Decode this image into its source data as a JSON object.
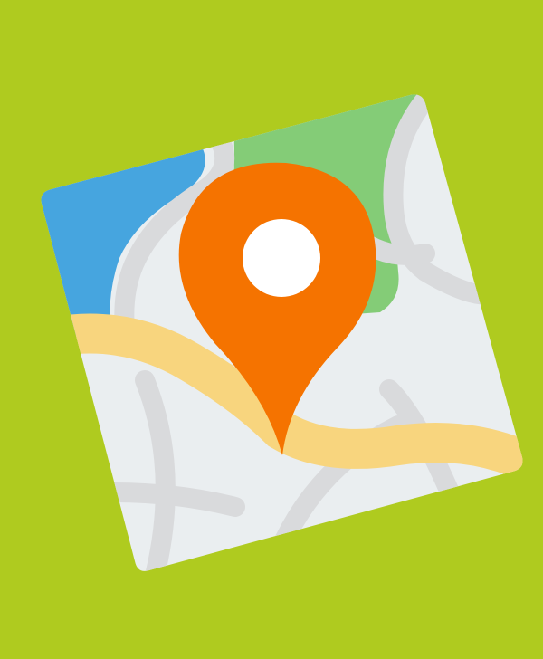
{
  "colors": {
    "background": "#AFCB1F",
    "map_base": "#EAEEF0",
    "water": "#46A5DF",
    "park": "#84CC77",
    "highway": "#F8D57E",
    "streets": "#D9DADC",
    "pin": "#F57300",
    "pin_dot": "#FFFFFF"
  },
  "icons": {
    "map": "map-icon",
    "pin": "location-pin-icon"
  }
}
